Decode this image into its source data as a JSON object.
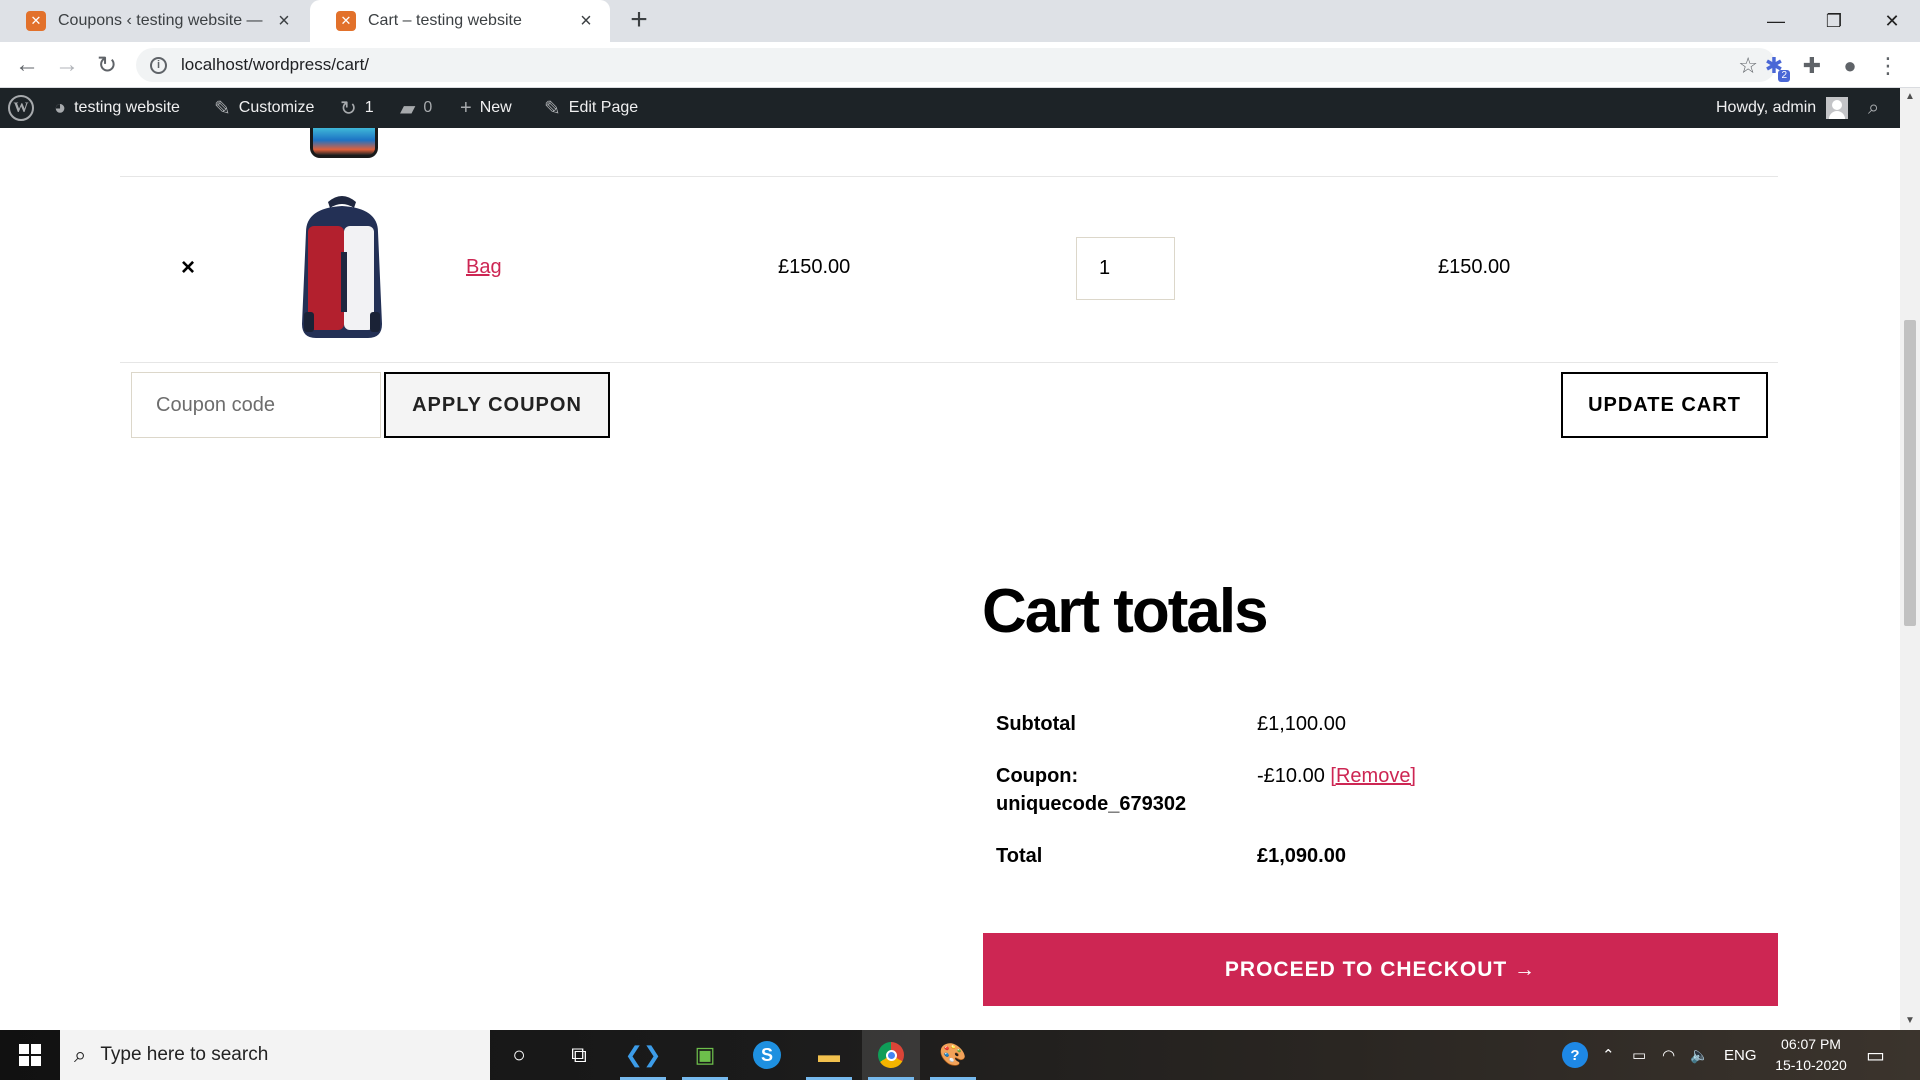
{
  "browser": {
    "tabs": [
      {
        "title": "Coupons ‹ testing website — Wo",
        "active": false
      },
      {
        "title": "Cart – testing website",
        "active": true
      }
    ],
    "url": "localhost/wordpress/cart/",
    "extension_badge": "2"
  },
  "adminbar": {
    "site_name": "testing website",
    "customize": "Customize",
    "updates_count": "1",
    "comments_count": "0",
    "new_label": "New",
    "edit_page": "Edit Page",
    "howdy": "Howdy, admin"
  },
  "cart": {
    "item": {
      "remove_symbol": "×",
      "name": "Bag",
      "price": "£150.00",
      "quantity": "1",
      "subtotal": "£150.00"
    },
    "coupon_placeholder": "Coupon code",
    "apply_coupon": "APPLY COUPON",
    "update_cart": "UPDATE CART"
  },
  "totals": {
    "heading": "Cart totals",
    "subtotal_label": "Subtotal",
    "subtotal_value": "£1,100.00",
    "coupon_label_1": "Coupon:",
    "coupon_label_2": "uniquecode_679302",
    "coupon_value": "-£10.00",
    "coupon_remove": "[Remove]",
    "total_label": "Total",
    "total_value": "£1,090.00",
    "checkout": "PROCEED TO CHECKOUT →"
  },
  "taskbar": {
    "search_placeholder": "Type here to search",
    "language": "ENG",
    "time": "06:07 PM",
    "date": "15-10-2020"
  },
  "colors": {
    "accent": "#cd2653",
    "adminbar": "#1d2327"
  }
}
